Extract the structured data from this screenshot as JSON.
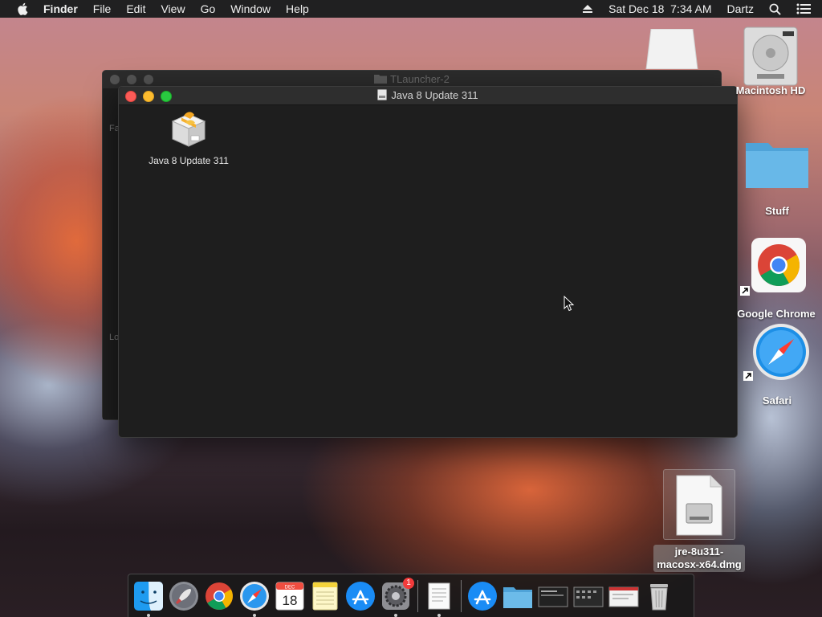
{
  "menubar": {
    "items": [
      "Finder",
      "File",
      "Edit",
      "View",
      "Go",
      "Window",
      "Help"
    ],
    "datetime": "Sat Dec 18  7:34 AM",
    "user": "Dartz"
  },
  "back_window": {
    "title": "TLauncher-2",
    "side_text_1": "Fa",
    "side_text_2": "Lo"
  },
  "front_window": {
    "title": "Java 8 Update 311",
    "item_label": "Java 8 Update 311"
  },
  "desktop": {
    "icons": [
      {
        "label": "Macintosh HD"
      },
      {
        "label": "Stuff"
      },
      {
        "label": "Google Chrome"
      },
      {
        "label": "Safari"
      },
      {
        "label": "jre-8u311-"
      },
      {
        "label": "macosx-x64.dmg"
      }
    ]
  },
  "dock": {
    "calendar_month": "DEC",
    "calendar_day": "18",
    "sysprefs_badge": "1"
  }
}
